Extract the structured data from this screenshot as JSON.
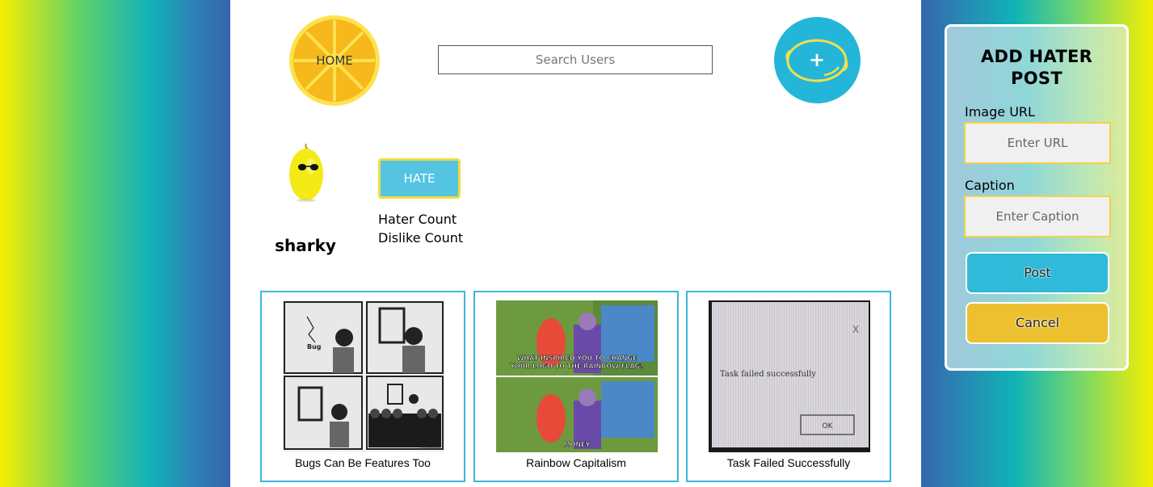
{
  "header": {
    "home_label": "HOME",
    "search_placeholder": "Search Users",
    "add_symbol": "+"
  },
  "profile": {
    "username": "sharky",
    "hate_button": "HATE",
    "hater_count_label": "Hater Count",
    "dislike_count_label": "Dislike Count"
  },
  "posts": [
    {
      "caption": "Bugs Can Be Features Too",
      "bug_label": "Bug",
      "watermark": "@hasekai"
    },
    {
      "caption": "Rainbow Capitalism",
      "top_text": "WHAT INSPIRED YOU TO CHANGE",
      "top_text2": "YOUR LOGO TO THE RAINBOW FLAG?",
      "bottom_text": "MONEY"
    },
    {
      "caption": "Task Failed Successfully",
      "dialog_text": "Task failed successfully",
      "ok_label": "OK",
      "close_label": "X"
    }
  ],
  "panel": {
    "title_line1": "ADD HATER",
    "title_line2": "POST",
    "image_url_label": "Image URL",
    "image_url_placeholder": "Enter URL",
    "caption_label": "Caption",
    "caption_placeholder": "Enter Caption",
    "post_button": "Post",
    "cancel_button": "Cancel"
  },
  "colors": {
    "accent_blue": "#24b6d8",
    "lemon_yellow": "#f7c12a",
    "cancel_yellow": "#ecc02f"
  }
}
